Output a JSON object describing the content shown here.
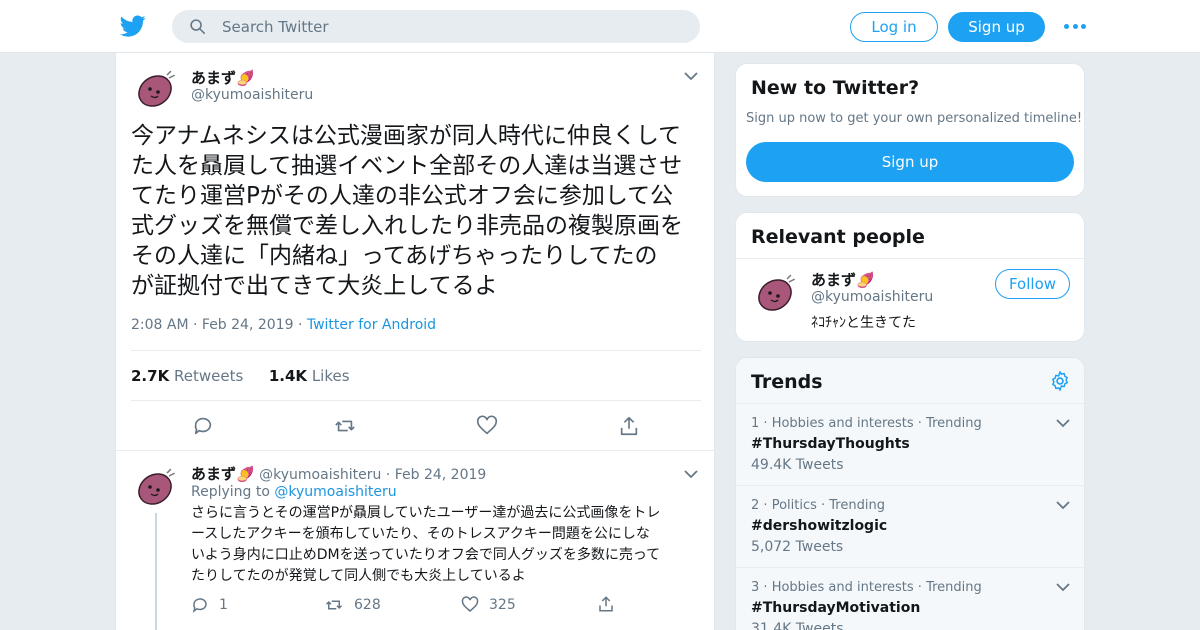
{
  "header": {
    "search_placeholder": "Search Twitter",
    "login_label": "Log in",
    "signup_label": "Sign up",
    "brand_color": "#1da1f2"
  },
  "tweet": {
    "name": "あまず🍠",
    "handle": "@kyumoaishiteru",
    "lines": [
      "今アナムネシスは公式漫画家が同人時代に仲良くして",
      "た人を贔屓して抽選イベント全部その人達は当選させ",
      "てたり運営Pがその人達の非公式オフ会に参加して公",
      "式グッズを無償で差し入れしたり非売品の複製原画を",
      "その人達に「内緒ね」ってあげちゃったりしてたの",
      "が証拠付で出てきて大炎上してるよ"
    ],
    "time": "2:08 AM",
    "date": "Feb 24, 2019",
    "source": "Twitter for Android",
    "retweets_count": "2.7K",
    "retweets_label": "Retweets",
    "likes_count": "1.4K",
    "likes_label": "Likes"
  },
  "reply": {
    "name": "あまず🍠",
    "handle": "@kyumoaishiteru",
    "date": "Feb 24, 2019",
    "replying_prefix": "Replying to",
    "replying_to": "@kyumoaishiteru",
    "lines": [
      "さらに言うとその運営Pが贔屓していたユーザー達が過去に公式画像をトレ",
      "ースしたアクキーを頒布していたり、そのトレスアクキー問題を公にしな",
      "いよう身内に口止めDMを送っていたりオフ会で同人グッズを多数に売って",
      "たりしてたのが発覚して同人側でも大炎上しているよ"
    ],
    "replies": "1",
    "retweets": "628",
    "likes": "325"
  },
  "new_to_twitter": {
    "title": "New to Twitter?",
    "subtitle": "Sign up now to get your own personalized timeline!",
    "button": "Sign up"
  },
  "relevant": {
    "title": "Relevant people",
    "name": "あまず🍠",
    "handle": "@kyumoaishiteru",
    "bio": "ﾈｺﾁｬﾝと生きてた",
    "follow_label": "Follow"
  },
  "trends": {
    "title": "Trends",
    "items": [
      {
        "rank": "1",
        "category": "Hobbies and interests",
        "status": "Trending",
        "tag": "#ThursdayThoughts",
        "count": "49.4K Tweets"
      },
      {
        "rank": "2",
        "category": "Politics",
        "status": "Trending",
        "tag": "#dershowitzlogic",
        "count": "5,072 Tweets"
      },
      {
        "rank": "3",
        "category": "Hobbies and interests",
        "status": "Trending",
        "tag": "#ThursdayMotivation",
        "count": "31.4K Tweets"
      }
    ]
  }
}
